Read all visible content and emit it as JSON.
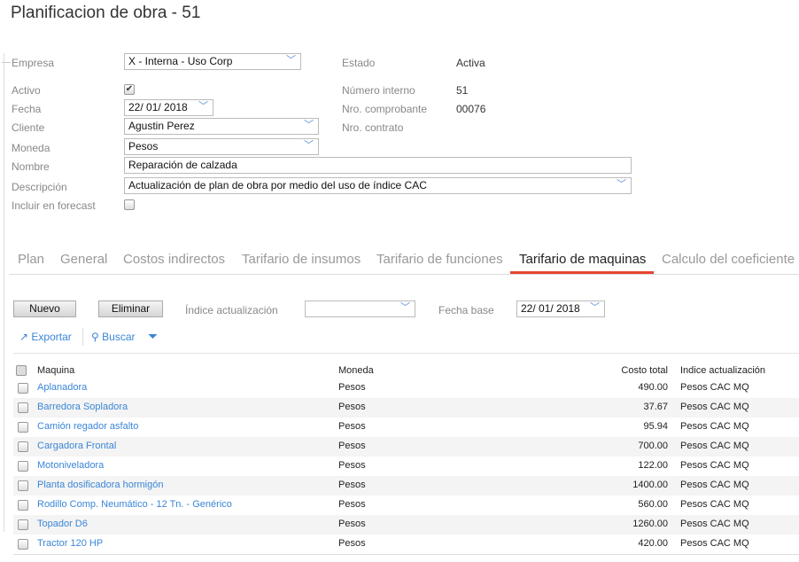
{
  "title": "Planificacion de obra - 51",
  "form": {
    "empresa_label": "Empresa",
    "empresa": "X - Interna - Uso Corp",
    "activo_label": "Activo",
    "fecha_label": "Fecha",
    "fecha": "22/ 01/ 2018",
    "cliente_label": "Cliente",
    "cliente": "Agustin Perez",
    "moneda_label": "Moneda",
    "moneda": "Pesos",
    "nombre_label": "Nombre",
    "nombre": "Reparación de calzada",
    "descripcion_label": "Descripción",
    "descripcion": "Actualización de plan de obra por medio del uso de índice CAC",
    "forecast_label": "Incluir en forecast",
    "estado_label": "Estado",
    "estado": "Activa",
    "numero_label": "Número interno",
    "numero": "51",
    "comprobante_label": "Nro. comprobante",
    "comprobante": "00076",
    "contrato_label": "Nro. contrato"
  },
  "tabs": [
    "Plan",
    "General",
    "Costos indirectos",
    "Tarifario de insumos",
    "Tarifario de funciones",
    "Tarifario de maquinas",
    "Calculo del coeficiente"
  ],
  "toolbar": {
    "nuevo": "Nuevo",
    "eliminar": "Eliminar",
    "indice_label": "Índice actualización",
    "indice": "",
    "fecha_base_label": "Fecha base",
    "fecha_base": "22/ 01/ 2018",
    "exportar": "Exportar",
    "buscar": "Buscar"
  },
  "table": {
    "headers": [
      "Maquina",
      "Moneda",
      "Costo total",
      "Indice actualización"
    ],
    "rows": [
      [
        "Aplanadora",
        "Pesos",
        "490.00",
        "Pesos CAC MQ"
      ],
      [
        "Barredora Sopladora",
        "Pesos",
        "37.67",
        "Pesos CAC MQ"
      ],
      [
        "Camión regador asfalto",
        "Pesos",
        "95.94",
        "Pesos CAC MQ"
      ],
      [
        "Cargadora Frontal",
        "Pesos",
        "700.00",
        "Pesos CAC MQ"
      ],
      [
        "Motoniveladora",
        "Pesos",
        "122.00",
        "Pesos CAC MQ"
      ],
      [
        "Planta dosificadora hormigón",
        "Pesos",
        "1400.00",
        "Pesos CAC MQ"
      ],
      [
        "Rodillo Comp. Neumático - 12 Tn. - Genérico",
        "Pesos",
        "560.00",
        "Pesos CAC MQ"
      ],
      [
        "Topador D6",
        "Pesos",
        "1260.00",
        "Pesos CAC MQ"
      ],
      [
        "Tractor 120 HP",
        "Pesos",
        "420.00",
        "Pesos CAC MQ"
      ]
    ]
  }
}
